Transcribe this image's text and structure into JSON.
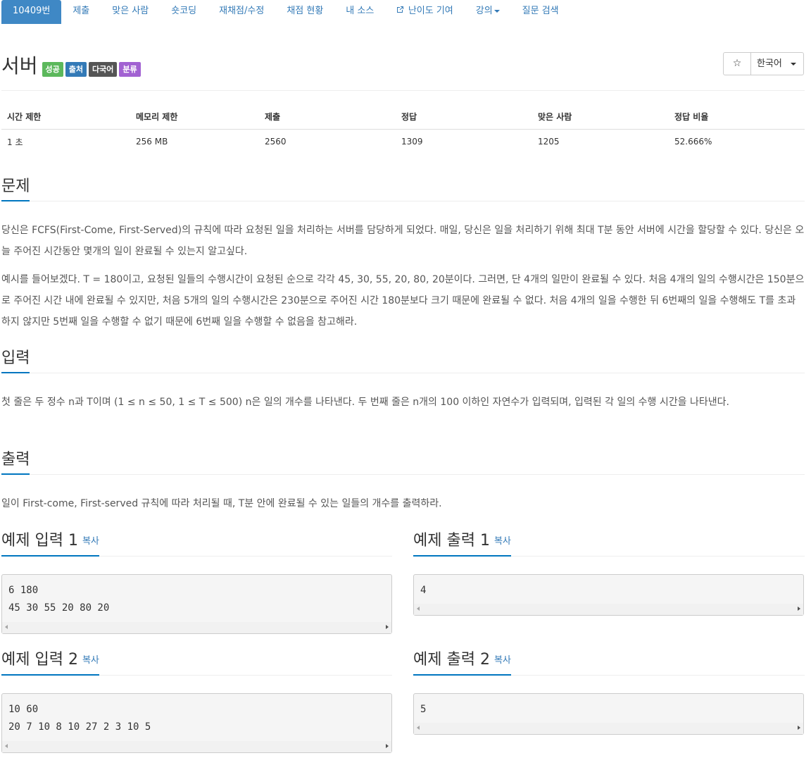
{
  "nav": {
    "tabs": [
      {
        "label": "10409번"
      },
      {
        "label": "제출"
      },
      {
        "label": "맞은 사람"
      },
      {
        "label": "숏코딩"
      },
      {
        "label": "재채점/수정"
      },
      {
        "label": "채점 현황"
      },
      {
        "label": "내 소스"
      },
      {
        "label": "난이도 기여",
        "icon": "external-link-icon"
      },
      {
        "label": "강의",
        "icon": "caret-down-icon"
      },
      {
        "label": "질문 검색"
      }
    ]
  },
  "problem": {
    "title": "서버",
    "badges": [
      {
        "label": "성공",
        "color": "#5cb85c"
      },
      {
        "label": "출처",
        "color": "#337ab7"
      },
      {
        "label": "다국어",
        "color": "#555555"
      },
      {
        "label": "분류",
        "color": "#a262d2"
      }
    ],
    "star_glyph": "☆",
    "language": "한국어"
  },
  "info_table": {
    "headers": [
      "시간 제한",
      "메모리 제한",
      "제출",
      "정답",
      "맞은 사람",
      "정답 비율"
    ],
    "values": [
      "1 초",
      "256 MB",
      "2560",
      "1309",
      "1205",
      "52.666%"
    ]
  },
  "sections": {
    "description": {
      "heading": "문제",
      "p1": "당신은 FCFS(First-Come, First-Served)의 규칙에 따라 요청된 일을 처리하는 서버를 담당하게 되었다. 매일, 당신은 일을 처리하기 위해 최대 T분 동안 서버에 시간을 할당할 수 있다. 당신은 오늘 주어진 시간동안 몇개의 일이 완료될 수 있는지 알고싶다.",
      "p2": "예시를 들어보겠다. T = 180이고, 요청된 일들의 수행시간이 요청된 순으로 각각 45, 30, 55, 20, 80, 20분이다. 그러면, 단 4개의 일만이 완료될 수 있다. 처음 4개의 일의 수행시간은 150분으로 주어진 시간 내에 완료될 수 있지만, 처음 5개의 일의 수행시간은 230분으로 주어진 시간 180분보다 크기 때문에 완료될 수 없다. 처음 4개의 일을 수행한 뒤 6번째의 일을 수행해도 T를 초과하지 않지만 5번째 일을 수행할 수 없기 때문에 6번째 일을 수행할 수 없음을 참고해라."
    },
    "input": {
      "heading": "입력",
      "p1": "첫 줄은 두 정수 n과 T이며 (1 ≤ n ≤ 50, 1 ≤ T ≤ 500) n은 일의 개수를 나타낸다. 두 번째 줄은 n개의 100 이하인 자연수가 입력되며, 입력된 각 일의 수행 시간을 나타낸다."
    },
    "output": {
      "heading": "출력",
      "p1": "일이 First-come, First-served 규칙에 따라 처리될 때, T분 안에 완료될 수 있는 일들의 개수를 출력하라."
    }
  },
  "samples": {
    "copy_label": "복사",
    "in1": {
      "heading": "예제 입력 1",
      "line1": "6 180",
      "line2": "45 30 55 20 80 20"
    },
    "out1": {
      "heading": "예제 출력 1",
      "line1": "4"
    },
    "in2": {
      "heading": "예제 입력 2",
      "line1": "10 60",
      "line2": "20 7 10 8 10 27 2 3 10 5"
    },
    "out2": {
      "heading": "예제 출력 2",
      "line1": "5"
    }
  }
}
